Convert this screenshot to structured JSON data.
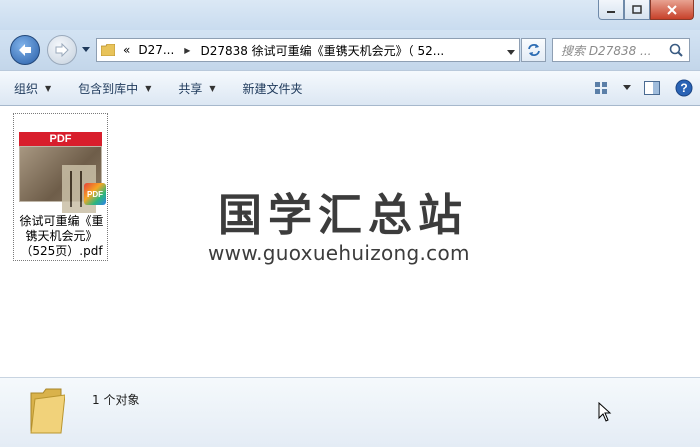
{
  "window": {
    "minimize_icon": "minimize-icon",
    "maximize_icon": "maximize-icon",
    "close_icon": "close-icon"
  },
  "nav": {
    "breadcrumb": [
      "«",
      "D27...",
      "D27838 徐试可重编《重镌天机会元》（ 52..."
    ],
    "search_placeholder": "搜索 D27838 ..."
  },
  "toolbar": {
    "items": [
      "组织",
      "包含到库中",
      "共享",
      "新建文件夹"
    ]
  },
  "content": {
    "file": {
      "thumb_label": "PDF",
      "badge": "PDF",
      "name": "徐试可重编《重镌天机会元》（525页）.pdf"
    },
    "watermark": {
      "title": "国学汇总站",
      "url": "www.guoxuehuizong.com"
    }
  },
  "status": {
    "count_text": "1 个对象"
  },
  "colors": {
    "accent": "#1e395b",
    "pdf_red": "#d81e2c"
  }
}
